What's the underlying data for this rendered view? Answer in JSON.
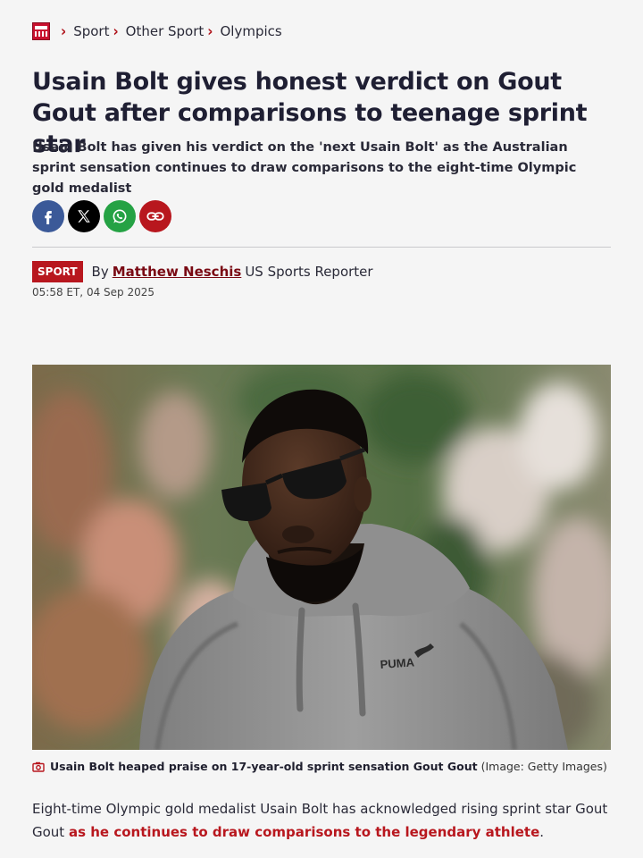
{
  "breadcrumb": {
    "items": [
      "Sport",
      "Other Sport",
      "Olympics"
    ],
    "separator": ">"
  },
  "headline": "Usain Bolt gives honest verdict on Gout Gout after comparisons to teenage sprint star",
  "standfirst": "Usain Bolt has given his verdict on the 'next Usain Bolt' as the Australian sprint sensation continues to draw comparisons to the eight-time Olympic gold medalist",
  "share": {
    "buttons": [
      "facebook-icon",
      "x-icon",
      "whatsapp-icon",
      "link-icon"
    ]
  },
  "byline": {
    "badge": "SPORT",
    "prefix": "By",
    "author": "Matthew Neschis",
    "role": "US Sports Reporter",
    "date": "05:58 ET, 04 Sep 2025"
  },
  "image": {
    "caption": "Usain Bolt heaped praise on 17-year-old sprint sensation Gout Gout",
    "credit": "(Image: Getty Images)",
    "brand_text": "PUMA"
  },
  "body": {
    "text": "Eight-time Olympic gold medalist Usain Bolt has acknowledged rising sprint star Gout Gout",
    "link": "as he continues to draw comparisons to the legendary athlete",
    "end": "."
  },
  "colors": {
    "accent": "#b8171e",
    "author": "#7a0a14",
    "facebook": "#3b5998",
    "whatsapp": "#25a244"
  }
}
